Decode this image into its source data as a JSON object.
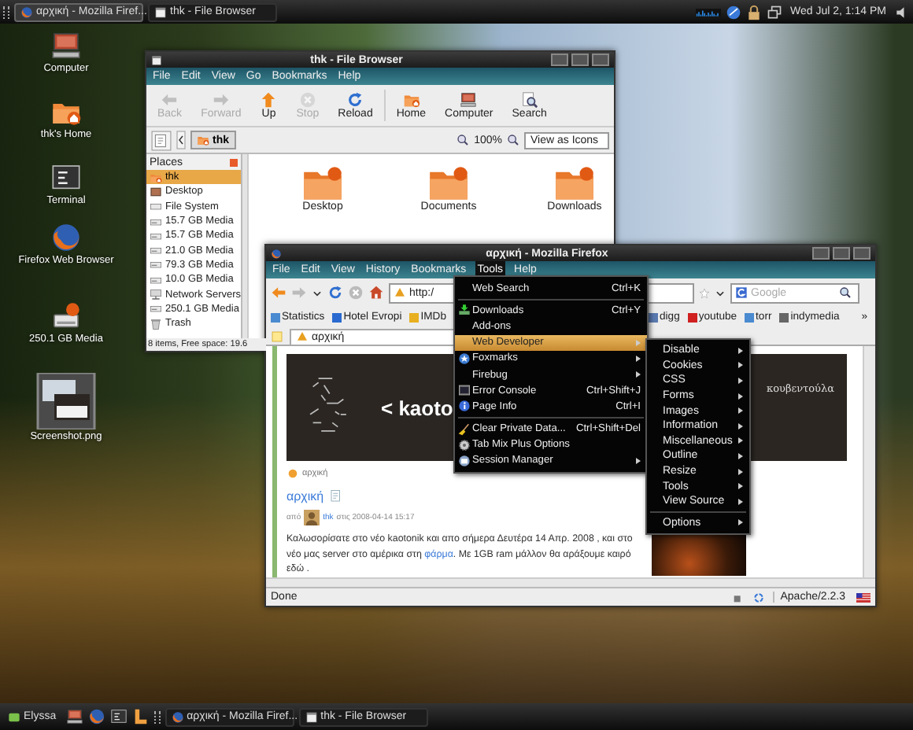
{
  "top_panel": {
    "tasks": [
      {
        "label": "αρχική - Mozilla Firef...",
        "selected": true
      },
      {
        "label": "thk - File Browser",
        "selected": false
      }
    ],
    "clock": "Wed Jul  2,  1:14 PM"
  },
  "desktop_icons": [
    {
      "label": "Computer",
      "kind": "computer"
    },
    {
      "label": "thk's Home",
      "kind": "home"
    },
    {
      "label": "Terminal",
      "kind": "terminal"
    },
    {
      "label": "Firefox Web Browser",
      "kind": "firefox"
    },
    {
      "label": "250.1 GB Media",
      "kind": "drive"
    },
    {
      "label": "Screenshot.png",
      "kind": "image"
    }
  ],
  "file_browser": {
    "title": "thk - File Browser",
    "menu": [
      "File",
      "Edit",
      "View",
      "Go",
      "Bookmarks",
      "Help"
    ],
    "toolbar": [
      {
        "label": "Back",
        "kind": "back",
        "disabled": true
      },
      {
        "label": "Forward",
        "kind": "forward",
        "disabled": true
      },
      {
        "label": "Up",
        "kind": "up",
        "disabled": false
      },
      {
        "label": "Stop",
        "kind": "stop",
        "disabled": true
      },
      {
        "label": "Reload",
        "kind": "reload",
        "disabled": false
      },
      {
        "label": "Home",
        "kind": "home",
        "disabled": false
      },
      {
        "label": "Computer",
        "kind": "computer",
        "disabled": false
      },
      {
        "label": "Search",
        "kind": "search",
        "disabled": false
      }
    ],
    "location": "thk",
    "zoom": "100%",
    "view_mode": "View as Icons",
    "places": {
      "title": "Places",
      "items": [
        {
          "label": "thk",
          "kind": "home",
          "selected": true
        },
        {
          "label": "Desktop",
          "kind": "desktop",
          "selected": false
        },
        {
          "label": "File System",
          "kind": "filesystem",
          "selected": false
        },
        {
          "label": "15.7 GB Media",
          "kind": "media",
          "selected": false
        },
        {
          "label": "15.7 GB Media",
          "kind": "media",
          "selected": false
        },
        {
          "label": "21.0 GB Media",
          "kind": "media",
          "selected": false
        },
        {
          "label": "79.3 GB Media",
          "kind": "media",
          "selected": false
        },
        {
          "label": "10.0 GB Media",
          "kind": "media",
          "selected": false
        },
        {
          "label": "Network Servers",
          "kind": "network",
          "selected": false
        },
        {
          "label": "250.1 GB Media",
          "kind": "media",
          "selected": false
        },
        {
          "label": "Trash",
          "kind": "trash",
          "selected": false
        }
      ]
    },
    "files": [
      {
        "label": "Desktop"
      },
      {
        "label": "Documents"
      },
      {
        "label": "Downloads"
      }
    ],
    "status": "8 items, Free space: 19.6"
  },
  "firefox": {
    "title": "αρχική - Mozilla Firefox",
    "menu": [
      {
        "label": "File",
        "selected": false
      },
      {
        "label": "Edit",
        "selected": false
      },
      {
        "label": "View",
        "selected": false
      },
      {
        "label": "History",
        "selected": false
      },
      {
        "label": "Bookmarks",
        "selected": false
      },
      {
        "label": "Tools",
        "selected": true
      },
      {
        "label": "Help",
        "selected": false
      }
    ],
    "url": "http:/",
    "search_placeholder": "Google",
    "bookmarks_left": [
      {
        "label": "Statistics",
        "kind": "stats"
      },
      {
        "label": "Hotel Evropi",
        "kind": "hotel"
      },
      {
        "label": "IMDb",
        "kind": "imdb"
      }
    ],
    "bookmarks_right": [
      {
        "label": "digg",
        "kind": "digg"
      },
      {
        "label": "youtube",
        "kind": "youtube"
      },
      {
        "label": "torr",
        "kind": "stats"
      },
      {
        "label": "indymedia",
        "kind": "indy"
      }
    ],
    "bookmarks_more": "»",
    "tab": "αρχική",
    "page": {
      "banner_title": "< kaoto",
      "banner_link": "κουβεντούλα",
      "breadcrumb": "αρχική",
      "heading": "αρχική",
      "byline_prefix": "από",
      "author": "thk",
      "byline_suffix": "στις 2008-04-14 15:17",
      "body": [
        {
          "text": "Καλωσορίσατε στο νέο kaotonik και απο σήμερα Δευτέρα 14 Απρ. 2008 , και στο νέο μας server στο αμέρικα στη ",
          "link": false
        },
        {
          "text": "φάρμα",
          "link": true
        },
        {
          "text": ". Με 1GB ram μάλλον θα αράξουμε καιρό εδώ .",
          "link": false
        }
      ]
    },
    "status": "Done",
    "server": "Apache/2.2.3"
  },
  "tools_menu": [
    {
      "kind": "item",
      "label": "Web Search",
      "shortcut": "Ctrl+K",
      "submenu": false,
      "selected": false
    },
    {
      "kind": "separator"
    },
    {
      "kind": "item",
      "label": "Downloads",
      "shortcut": "Ctrl+Y",
      "submenu": false,
      "selected": false
    },
    {
      "kind": "item",
      "label": "Add-ons",
      "submenu": false,
      "selected": false
    },
    {
      "kind": "item",
      "label": "Web Developer",
      "submenu": true,
      "selected": true
    },
    {
      "kind": "item",
      "label": "Foxmarks",
      "submenu": true,
      "selected": false
    },
    {
      "kind": "item",
      "label": "Firebug",
      "submenu": true,
      "selected": false
    },
    {
      "kind": "item",
      "label": "Error Console",
      "shortcut": "Ctrl+Shift+J",
      "submenu": false,
      "selected": false
    },
    {
      "kind": "item",
      "label": "Page Info",
      "shortcut": "Ctrl+I",
      "submenu": false,
      "selected": false
    },
    {
      "kind": "separator"
    },
    {
      "kind": "item",
      "label": "Clear Private Data...",
      "shortcut": "Ctrl+Shift+Del",
      "submenu": false,
      "selected": false
    },
    {
      "kind": "item",
      "label": "Tab Mix Plus Options",
      "submenu": false,
      "selected": false
    },
    {
      "kind": "item",
      "label": "Session Manager",
      "submenu": true,
      "selected": false
    }
  ],
  "web_developer_menu": [
    {
      "kind": "item",
      "label": "Disable",
      "submenu": true
    },
    {
      "kind": "item",
      "label": "Cookies",
      "submenu": true
    },
    {
      "kind": "item",
      "label": "CSS",
      "submenu": true
    },
    {
      "kind": "item",
      "label": "Forms",
      "submenu": true
    },
    {
      "kind": "item",
      "label": "Images",
      "submenu": true
    },
    {
      "kind": "item",
      "label": "Information",
      "submenu": true
    },
    {
      "kind": "item",
      "label": "Miscellaneous",
      "submenu": true
    },
    {
      "kind": "item",
      "label": "Outline",
      "submenu": true
    },
    {
      "kind": "item",
      "label": "Resize",
      "submenu": true
    },
    {
      "kind": "item",
      "label": "Tools",
      "submenu": true
    },
    {
      "kind": "item",
      "label": "View Source",
      "submenu": true
    },
    {
      "kind": "separator"
    },
    {
      "kind": "item",
      "label": "Options",
      "submenu": true
    }
  ],
  "bottom_panel": {
    "start": "Elyssa",
    "tasks": [
      {
        "label": "αρχική - Mozilla Firef...",
        "selected": false
      },
      {
        "label": "thk - File Browser",
        "selected": false
      }
    ]
  }
}
